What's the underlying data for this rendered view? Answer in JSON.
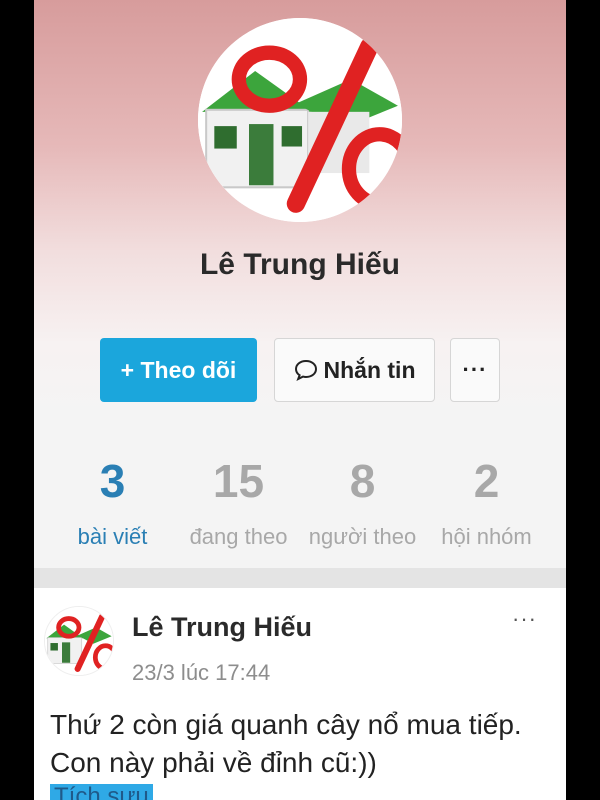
{
  "profile": {
    "name": "Lê Trung Hiếu"
  },
  "actions": {
    "follow_label": "+ Theo dõi",
    "message_label": "Nhắn tin",
    "more_label": "···"
  },
  "stats": [
    {
      "value": "3",
      "label": "bài viết"
    },
    {
      "value": "15",
      "label": "đang theo"
    },
    {
      "value": "8",
      "label": "người theo"
    },
    {
      "value": "2",
      "label": "hội nhóm"
    }
  ],
  "post": {
    "author": "Lê Trung Hiếu",
    "time": "23/3 lúc 17:44",
    "more_label": "···",
    "text": "Thứ 2 còn giá quanh cây nổ mua tiếp. Con này phải về đỉnh cũ:))",
    "tag": "Tích sưu"
  },
  "colors": {
    "accent": "#1ba6dc",
    "active_stat": "#2a7fb4",
    "header_top": "#d79c9c"
  },
  "icons": {
    "avatar": "house-percent-logo",
    "message": "speech-bubble-icon"
  }
}
